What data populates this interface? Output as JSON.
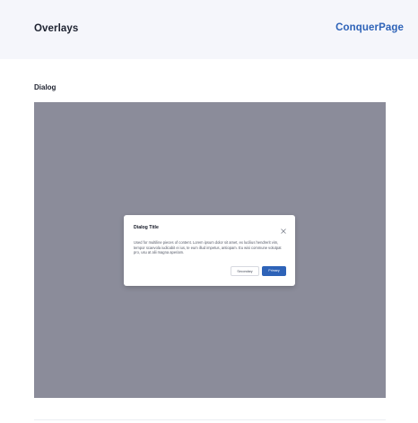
{
  "header": {
    "title": "Overlays",
    "brand": "ConquerPage"
  },
  "section": {
    "title": "Dialog"
  },
  "dialog": {
    "title": "Dialog Title",
    "body": "Used for multiline pieces of content. Lorem ipsum dolor sit amet, ex lucilius hendrerit vim, tempor scaevola iudicabit ei ius, te eum illud impetus, antiopam. Eu wisi commune volutpat pro, usu at alii magna aperiam.",
    "close_icon": "close-icon",
    "secondary_label": "Secondary",
    "primary_label": "Primary"
  },
  "colors": {
    "accent": "#2e63b8",
    "overlay": "#8b8c9a",
    "header_bg": "#f5f6fb"
  }
}
